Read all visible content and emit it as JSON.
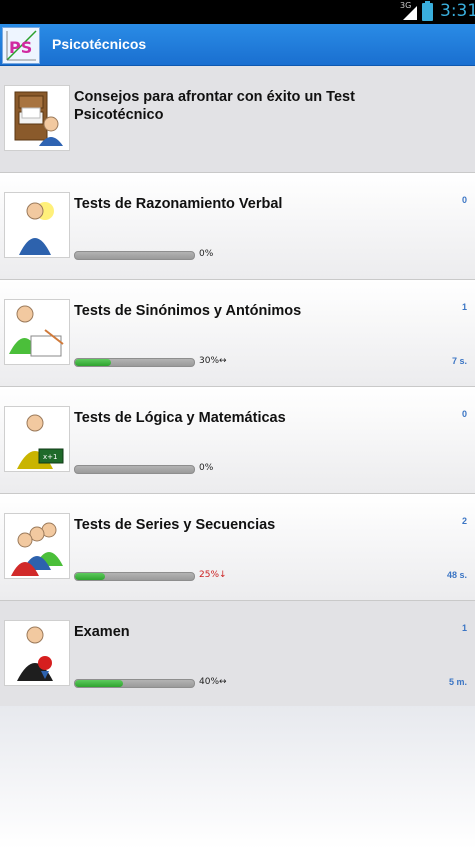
{
  "status_bar": {
    "network_label": "3G",
    "time": "3:31"
  },
  "app_bar": {
    "logo_text": "PS",
    "title": "Psicotécnicos"
  },
  "items": [
    {
      "title": "Consejos para afrontar con éxito un Test Psicotécnico",
      "icon": "file-cabinet-person-icon",
      "has_progress": false
    },
    {
      "title": "Tests de Razonamiento Verbal",
      "icon": "person-lightbulb-icon",
      "count": "0",
      "progress": 0,
      "percent_label": "0%",
      "trend": "",
      "time": ""
    },
    {
      "title": "Tests de Sinónimos y Antónimos",
      "icon": "person-reading-icon",
      "count": "1",
      "progress": 30,
      "percent_label": "30%",
      "trend": "↔",
      "time": "7 s."
    },
    {
      "title": "Tests de Lógica y Matemáticas",
      "icon": "person-chalkboard-icon",
      "count": "0",
      "progress": 0,
      "percent_label": "0%",
      "trend": "",
      "time": ""
    },
    {
      "title": "Tests de Series y Secuencias",
      "icon": "group-people-icon",
      "count": "2",
      "progress": 25,
      "percent_label": "25%",
      "trend": "↓",
      "time": "48 s."
    },
    {
      "title": "Examen",
      "icon": "person-exam-icon",
      "count": "1",
      "progress": 40,
      "percent_label": "40%",
      "trend": "↔",
      "time": "5 m."
    }
  ],
  "colors": {
    "action_bar": "#1a6fd0",
    "accent_blue": "#3b75c4",
    "progress_green": "#2ea32e",
    "trend_down": "#cc2222"
  }
}
